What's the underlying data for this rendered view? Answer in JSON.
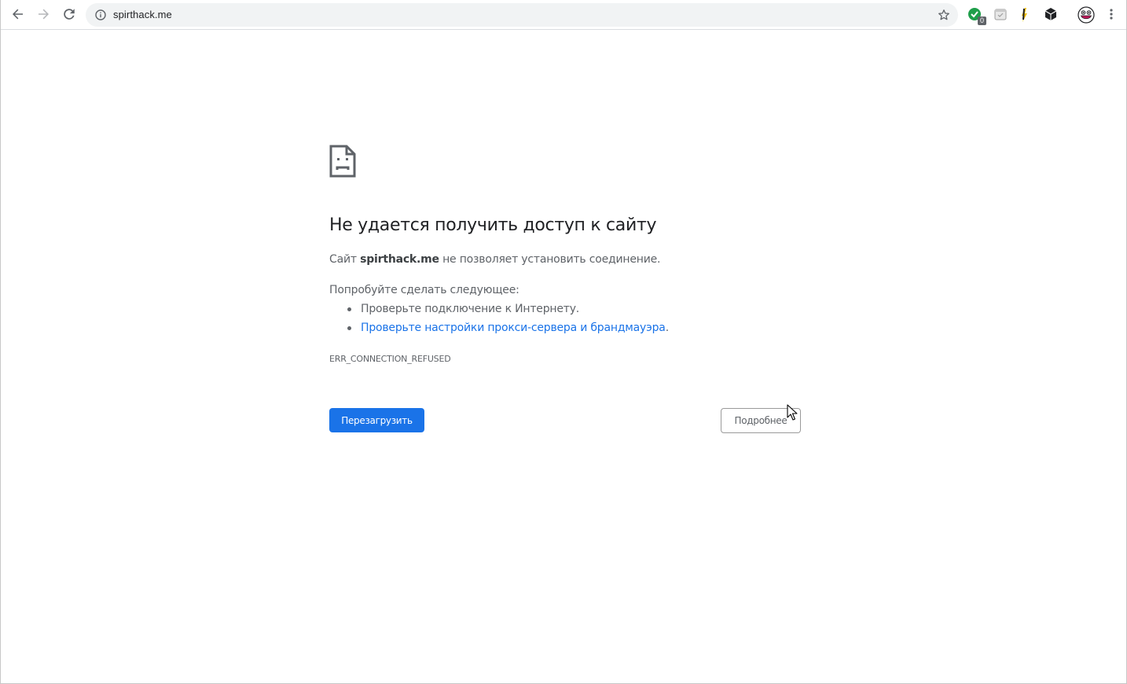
{
  "browser": {
    "url": "spirthack.me",
    "extension_badge": "0"
  },
  "error": {
    "title": "Не удается получить доступ к сайту",
    "desc_prefix": "Сайт ",
    "host": "spirthack.me",
    "desc_suffix": " не позволяет установить соединение.",
    "suggest_title": "Попробуйте сделать следующее:",
    "suggestion_1": "Проверьте подключение к Интернету.",
    "suggestion_2_link": "Проверьте настройки прокси-сервера и брандмауэра",
    "suggestion_2_suffix": ".",
    "code": "ERR_CONNECTION_REFUSED",
    "reload_label": "Перезагрузить",
    "details_label": "Подробнее"
  },
  "colors": {
    "accent": "#1a73e8",
    "text_primary": "#202124",
    "text_secondary": "#5f6368",
    "omnibox_bg": "#f1f3f4"
  },
  "icons": {
    "back": "arrow-left-icon",
    "forward": "arrow-right-icon",
    "reload": "reload-icon",
    "info": "info-icon",
    "bookmark": "star-icon",
    "menu": "kebab-menu-icon",
    "error": "sad-page-icon"
  }
}
